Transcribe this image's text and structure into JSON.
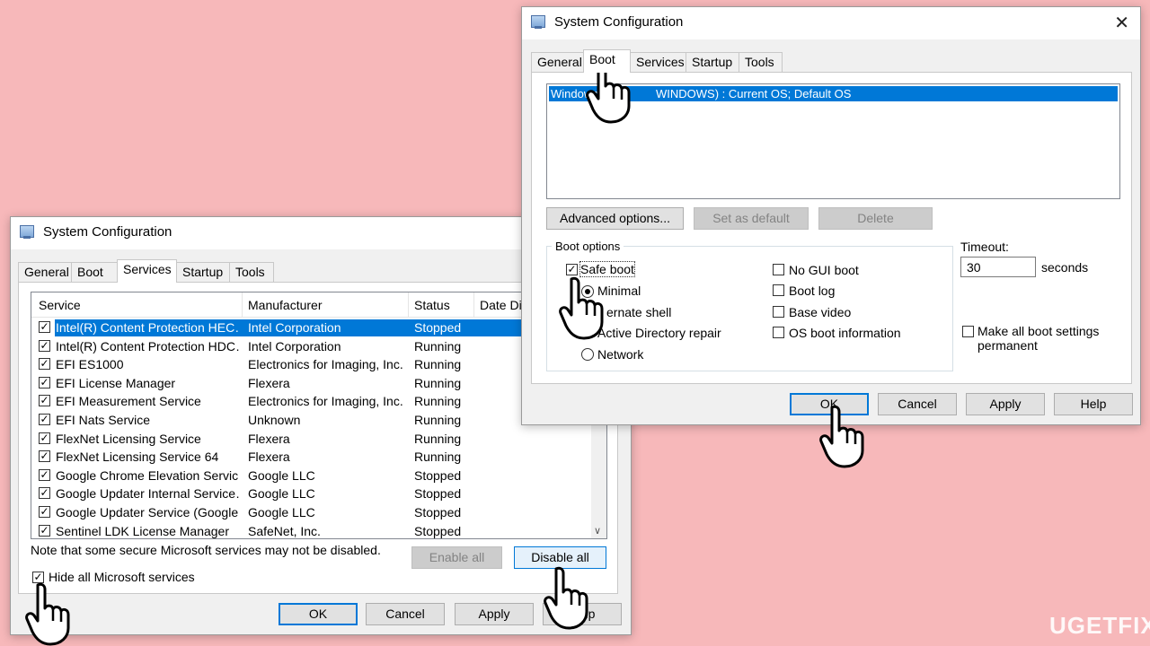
{
  "back_window": {
    "title": "System Configuration",
    "tabs": [
      "General",
      "Boot",
      "Services",
      "Startup",
      "Tools"
    ],
    "active_tab": "Services",
    "columns": [
      "Service",
      "Manufacturer",
      "Status",
      "Date Dis"
    ],
    "rows": [
      {
        "checked": true,
        "service": "Intel(R) Content Protection HEC…",
        "manufacturer": "Intel Corporation",
        "status": "Stopped",
        "selected": true
      },
      {
        "checked": true,
        "service": "Intel(R) Content Protection HDC…",
        "manufacturer": "Intel Corporation",
        "status": "Running"
      },
      {
        "checked": true,
        "service": "EFI ES1000",
        "manufacturer": "Electronics for Imaging, Inc.",
        "status": "Running"
      },
      {
        "checked": true,
        "service": "EFI License Manager",
        "manufacturer": "Flexera",
        "status": "Running"
      },
      {
        "checked": true,
        "service": "EFI Measurement Service",
        "manufacturer": "Electronics for Imaging, Inc.",
        "status": "Running"
      },
      {
        "checked": true,
        "service": "EFI Nats Service",
        "manufacturer": "Unknown",
        "status": "Running"
      },
      {
        "checked": true,
        "service": "FlexNet Licensing Service",
        "manufacturer": "Flexera",
        "status": "Running"
      },
      {
        "checked": true,
        "service": "FlexNet Licensing Service 64",
        "manufacturer": "Flexera",
        "status": "Running"
      },
      {
        "checked": true,
        "service": "Google Chrome Elevation Servic…",
        "manufacturer": "Google LLC",
        "status": "Stopped"
      },
      {
        "checked": true,
        "service": "Google Updater Internal Service…",
        "manufacturer": "Google LLC",
        "status": "Stopped"
      },
      {
        "checked": true,
        "service": "Google Updater Service (Google…",
        "manufacturer": "Google LLC",
        "status": "Stopped"
      },
      {
        "checked": true,
        "service": "Sentinel LDK License Manager",
        "manufacturer": "SafeNet, Inc.",
        "status": "Stopped"
      }
    ],
    "note": "Note that some secure Microsoft services may not be disabled.",
    "enable_all": "Enable all",
    "disable_all": "Disable all",
    "hide_ms_label": "Hide all Microsoft services",
    "hide_ms_checked": true,
    "ok": "OK",
    "cancel": "Cancel",
    "apply": "Apply",
    "help": "Help"
  },
  "front_window": {
    "title": "System Configuration",
    "close_glyph": "✕",
    "tabs": [
      "General",
      "Boot",
      "Services",
      "Startup",
      "Tools"
    ],
    "active_tab": "Boot",
    "os_entry_visible": [
      "Windows",
      "WINDOWS) : Current OS; Default OS"
    ],
    "advanced_options": "Advanced options...",
    "set_default": "Set as default",
    "delete": "Delete",
    "boot_options_label": "Boot options",
    "safe_boot_label": "Safe boot",
    "safe_boot_checked": true,
    "radios": [
      {
        "label": "Minimal",
        "selected": true
      },
      {
        "label": "ernate shell",
        "selected": false
      },
      {
        "label": "Active Directory repair",
        "selected": false
      },
      {
        "label": "Network",
        "selected": false
      }
    ],
    "right_checks": [
      "No GUI boot",
      "Boot log",
      "Base video",
      "OS boot information"
    ],
    "timeout_label": "Timeout:",
    "timeout_value": "30",
    "seconds_label": "seconds",
    "make_permanent_line1": "Make all boot settings",
    "make_permanent_line2": "permanent",
    "ok": "OK",
    "cancel": "Cancel",
    "apply": "Apply",
    "help": "Help"
  },
  "watermark": "UGETFIX",
  "colors": {
    "background": "#f7b8ba",
    "selection": "#0078d7",
    "focus_border": "#0078d7"
  },
  "icons": [
    "system-config-icon",
    "close-icon",
    "checkmark-icon",
    "scroll-down-icon",
    "pointer-hand-icon"
  ]
}
